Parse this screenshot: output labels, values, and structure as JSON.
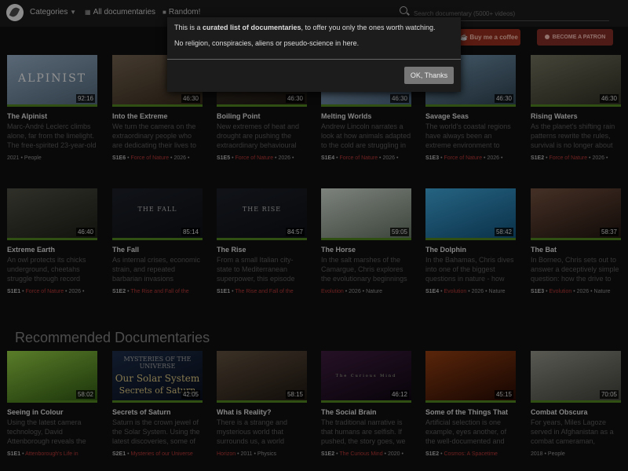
{
  "nav": {
    "categories": "Categories",
    "all": "All documentaries",
    "random": "Random!",
    "search_placeholder": "Search documentary (5000+ videos)"
  },
  "buttons": {
    "coffee": "Buy me a coffee",
    "patron": "BECOME A PATRON"
  },
  "modal": {
    "pre": "This is a ",
    "strong": "curated list of documentaries",
    "post": ", to offer you only the ones worth watching.",
    "line2": "No religion, conspiracies, aliens or pseudo-science in here.",
    "ok": "OK, Thanks"
  },
  "section_title": "Recommended Documentaries",
  "cards": [
    {
      "title": "The Alpinist",
      "duration": "92:16",
      "thumb_text": "ALPINIST",
      "desc": "Marc-André Leclerc climbs alone, far from the limelight. The free-spirited 23-year-old",
      "meta": {
        "year": "2021",
        "tag": "People"
      },
      "colors": [
        "#8aa0b6",
        "#4a5e70"
      ]
    },
    {
      "title": "Into the Extreme",
      "duration": "46:30",
      "desc": "We turn the camera on the extraordinary people who are dedicating their lives to",
      "meta": {
        "ep": "S1E6",
        "series": "Force of Nature",
        "year": "2026"
      },
      "colors": [
        "#6a5a48",
        "#2f2418"
      ]
    },
    {
      "title": "Boiling Point",
      "duration": "46:30",
      "desc": "New extremes of heat and drought are pushing the extraordinary behavioural",
      "meta": {
        "ep": "S1E5",
        "series": "Force of Nature",
        "year": "2026"
      },
      "colors": [
        "#3a3026",
        "#1a1510"
      ]
    },
    {
      "title": "Melting Worlds",
      "duration": "46:30",
      "desc": "Andrew Lincoln narrates a look at how animals adapted to the cold are struggling in a",
      "meta": {
        "ep": "S1E4",
        "series": "Force of Nature",
        "year": "2026"
      },
      "colors": [
        "#8fa8c0",
        "#405870"
      ]
    },
    {
      "title": "Savage Seas",
      "duration": "46:30",
      "desc": "The world's coastal regions have always been an extreme environment to raise",
      "meta": {
        "ep": "S1E3",
        "series": "Force of Nature",
        "year": "2026"
      },
      "colors": [
        "#6a8aa0",
        "#2a3c4a"
      ]
    },
    {
      "title": "Rising Waters",
      "duration": "46:30",
      "desc": "As the planet's shifting rain patterns rewrite the rules, survival is no longer about",
      "meta": {
        "ep": "S1E2",
        "series": "Force of Nature",
        "year": "2026"
      },
      "colors": [
        "#6a6a58",
        "#2a2a20"
      ]
    },
    {
      "title": "Extreme Earth",
      "duration": "46:40",
      "desc": "An owl protects its chicks underground, cheetahs struggle through record",
      "meta": {
        "ep": "S1E1",
        "series": "Force of Nature",
        "year": "2026"
      },
      "colors": [
        "#4a4a40",
        "#1a1a14"
      ]
    },
    {
      "title": "The Fall",
      "duration": "85:14",
      "thumb_text": "THE FALL",
      "desc": "As internal crises, economic strain, and repeated barbarian invasions intensify,",
      "meta": {
        "ep": "S1E2",
        "series": "The Rise and Fall of the"
      },
      "colors": [
        "#1a1e26",
        "#0c0e12"
      ]
    },
    {
      "title": "The Rise",
      "duration": "84:57",
      "thumb_text": "THE RISE",
      "desc": "From a small Italian city-state to Mediterranean superpower, this episode",
      "meta": {
        "ep": "S1E1",
        "series": "The Rise and Fall of the"
      },
      "colors": [
        "#1a1e26",
        "#0c0e12"
      ]
    },
    {
      "title": "The Horse",
      "duration": "59:05",
      "desc": "In the salt marshes of the Camargue, Chris explores the evolutionary beginnings",
      "meta": {
        "series": "Evolution",
        "year": "2026",
        "tag": "Nature"
      },
      "colors": [
        "#c0c8c0",
        "#5a6858"
      ]
    },
    {
      "title": "The Dolphin",
      "duration": "58:42",
      "desc": "In the Bahamas, Chris dives into one of the biggest questions in nature - how",
      "meta": {
        "ep": "S1E4",
        "series": "Evolution",
        "year": "2026",
        "tag": "Nature"
      },
      "colors": [
        "#3a9ac8",
        "#104a70"
      ]
    },
    {
      "title": "The Bat",
      "duration": "58:37",
      "desc": "In Borneo, Chris sets out to answer a deceptively simple question: how the drive to",
      "meta": {
        "ep": "S1E3",
        "series": "Evolution",
        "year": "2026",
        "tag": "Nature"
      },
      "colors": [
        "#6a4a3a",
        "#1a100c"
      ]
    },
    {
      "title": "Seeing in Colour",
      "duration": "58:02",
      "desc": "Using the latest camera technology, David Attenborough reveals the",
      "meta": {
        "ep": "S1E1",
        "series": "Attenborough's Life in"
      },
      "colors": [
        "#8ac040",
        "#2a5010"
      ]
    },
    {
      "title": "Secrets of Saturn",
      "duration": "42:05",
      "thumb_lines": [
        "MYSTERIES OF THE UNIVERSE",
        "Our Solar System",
        "Secrets of Saturn"
      ],
      "desc": "Saturn is the crown jewel of the Solar System. Using the latest discoveries, some of",
      "meta": {
        "ep": "S2E1",
        "series": "Mysteries of our Universe"
      },
      "colors": [
        "#1a2a44",
        "#080c18"
      ]
    },
    {
      "title": "What is Reality?",
      "duration": "58:15",
      "desc": "There is a strange and mysterious world that surrounds us, a world largely",
      "meta": {
        "series": "Horizon",
        "year": "2011",
        "tag": "Physics"
      },
      "colors": [
        "#5a4a3a",
        "#1a140e"
      ]
    },
    {
      "title": "The Social Brain",
      "duration": "46:12",
      "thumb_text": "The Curious Mind",
      "desc": "The traditional narrative is that humans are selfish. If pushed, the story goes, we",
      "meta": {
        "ep": "S1E2",
        "series": "The Curious Mind",
        "year": "2020"
      },
      "colors": [
        "#3a1a3a",
        "#0c0610"
      ]
    },
    {
      "title": "Some of the Things That",
      "duration": "45:15",
      "desc": "Artificial selection is one example, eyes another, of the well-documented and",
      "meta": {
        "ep": "S1E2",
        "series": "Cosmos: A Spacetime"
      },
      "colors": [
        "#8a3a10",
        "#200804"
      ]
    },
    {
      "title": "Combat Obscura",
      "duration": "70:05",
      "desc": "For years, Miles Lagoze served in Afghanistan as a combat cameraman,",
      "meta": {
        "year": "2018",
        "tag": "People"
      },
      "colors": [
        "#8a8a80",
        "#3a3a34"
      ]
    }
  ]
}
